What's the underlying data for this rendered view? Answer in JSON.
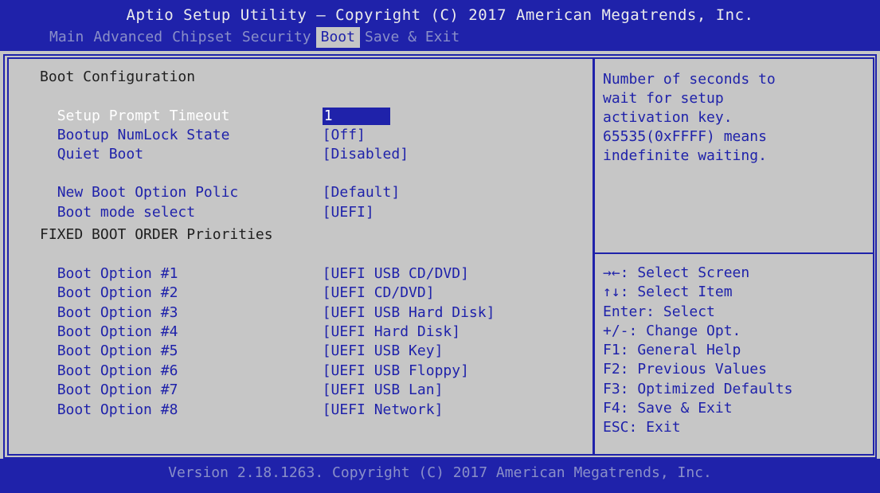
{
  "header": {
    "title": "Aptio Setup Utility – Copyright (C) 2017 American Megatrends, Inc.",
    "tabs": [
      "Main",
      "Advanced",
      "Chipset",
      "Security",
      "Boot",
      "Save & Exit"
    ],
    "active_tab": "Boot"
  },
  "left": {
    "section_title": "Boot Configuration",
    "setup_prompt_timeout": {
      "label": "Setup Prompt Timeout",
      "value": "1"
    },
    "bootup_numlock": {
      "label": "Bootup NumLock State",
      "value": "[Off]"
    },
    "quiet_boot": {
      "label": "Quiet Boot",
      "value": "[Disabled]"
    },
    "new_boot_option_policy": {
      "label": "New Boot Option Polic",
      "value": "[Default]"
    },
    "boot_mode_select": {
      "label": "Boot mode select",
      "value": "[UEFI]"
    },
    "fixed_order_title": "FIXED BOOT ORDER Priorities",
    "boot_options": [
      {
        "label": "Boot Option #1",
        "value": "[UEFI USB CD/DVD]"
      },
      {
        "label": "Boot Option #2",
        "value": "[UEFI CD/DVD]"
      },
      {
        "label": "Boot Option #3",
        "value": "[UEFI USB Hard Disk]"
      },
      {
        "label": "Boot Option #4",
        "value": "[UEFI Hard Disk]"
      },
      {
        "label": "Boot Option #5",
        "value": "[UEFI USB Key]"
      },
      {
        "label": "Boot Option #6",
        "value": "[UEFI USB Floppy]"
      },
      {
        "label": "Boot Option #7",
        "value": "[UEFI USB Lan]"
      },
      {
        "label": "Boot Option #8",
        "value": "[UEFI Network]"
      }
    ]
  },
  "help": {
    "description": "Number of seconds to\nwait for setup\nactivation key.\n65535(0xFFFF) means\nindefinite waiting.",
    "keys": [
      "→←: Select Screen",
      "↑↓: Select Item",
      "Enter: Select",
      "+/-: Change Opt.",
      "F1: General Help",
      "F2: Previous Values",
      "F3: Optimized Defaults",
      "F4: Save & Exit",
      "ESC: Exit"
    ]
  },
  "footer": {
    "text": "Version 2.18.1263. Copyright (C) 2017 American Megatrends, Inc."
  },
  "colors": {
    "bios_blue": "#1f22aa",
    "background_gray": "#c6c6c6",
    "highlight_white": "#ffffff"
  }
}
